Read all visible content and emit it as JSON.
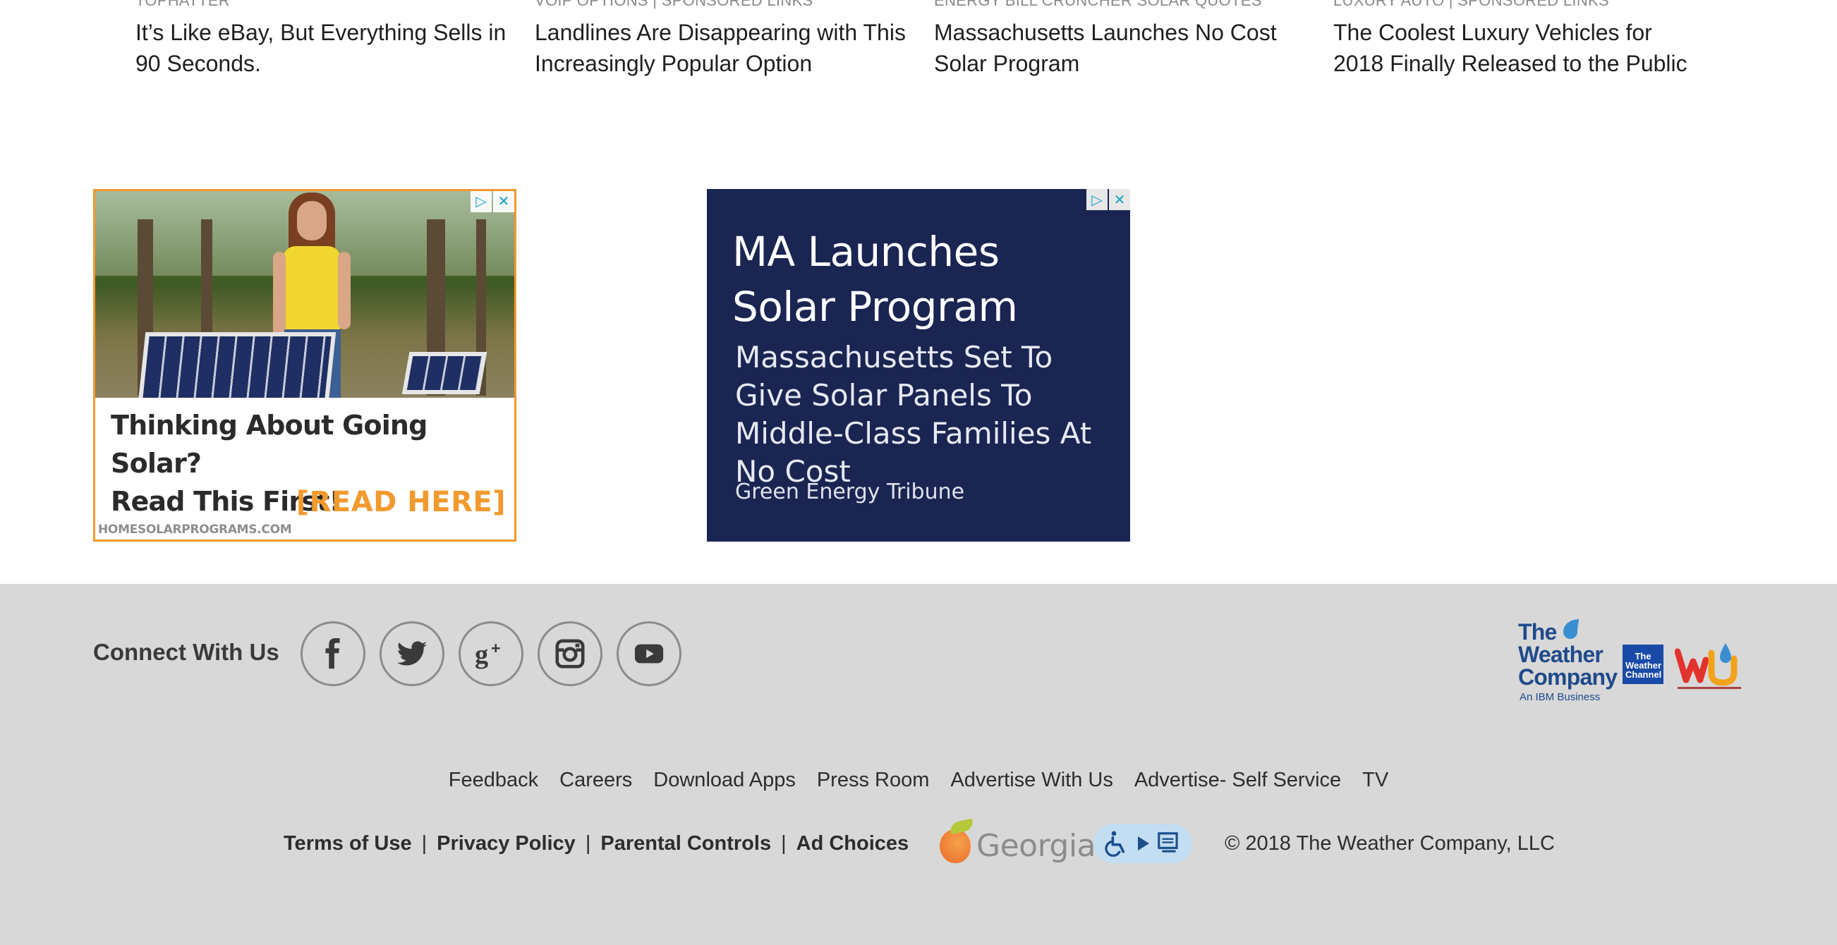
{
  "stories": [
    {
      "source": "Tophatter",
      "headline": "It’s Like eBay, But Everything Sells in 90 Seconds."
    },
    {
      "source": "VoIP Options | Sponsored Links",
      "headline": "Landlines Are Disappearing with This Increasingly Popular Option"
    },
    {
      "source": "Energy Bill Cruncher Solar Quotes",
      "headline": "Massachusetts Launches No Cost Solar Program"
    },
    {
      "source": "Luxury Auto | Sponsored Links",
      "headline": "The Coolest Luxury Vehicles for 2018 Finally Released to the Public"
    }
  ],
  "ad_solar": {
    "line1": "Thinking About Going Solar?",
    "line2": "Read This First!",
    "cta": "[READ HERE]",
    "domain": "HOMESOLARPROGRAMS.COM",
    "border_color": "#f29a2e"
  },
  "ad_tribune": {
    "headline": "MA Launches Solar Program",
    "body": "Massachusetts Set To Give Solar Panels To Middle-Class Families At No Cost",
    "source": "Green Energy Tribune",
    "background": "#1b2552"
  },
  "ad_controls": {
    "adchoices_icon": "adchoices-icon",
    "close_icon": "close-icon"
  },
  "footer": {
    "connect_label": "Connect With Us",
    "socials": [
      "facebook-icon",
      "twitter-icon",
      "google-plus-icon",
      "instagram-icon",
      "youtube-icon"
    ],
    "brand": {
      "line1": "The",
      "line2": "Weather",
      "line3": "Company",
      "sub": "An IBM Business",
      "channel_line1": "The",
      "channel_line2": "Weather",
      "channel_line3": "Channel"
    },
    "nav": [
      "Feedback",
      "Careers",
      "Download Apps",
      "Press Room",
      "Advertise With Us",
      "Advertise- Self Service",
      "TV"
    ],
    "legal": [
      "Terms of Use",
      "Privacy Policy",
      "Parental Controls",
      "Ad Choices"
    ],
    "georgia": "Georgia",
    "copyright": "© 2018 The Weather Company, LLC",
    "background": "#d8d8d8"
  }
}
